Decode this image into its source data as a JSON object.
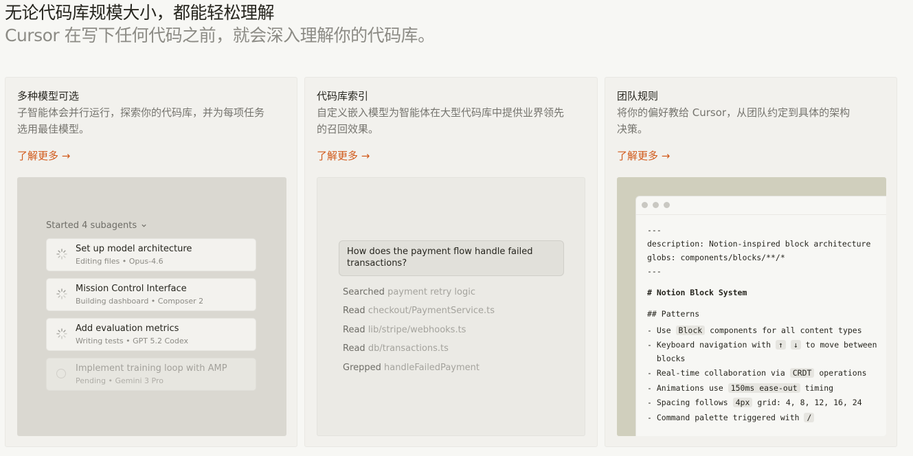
{
  "hero": {
    "title": "无论代码库规模大小，都能轻松理解",
    "subtitle": "Cursor 在写下任何代码之前，就会深入理解你的代码库。"
  },
  "colors": {
    "accent": "#d15a1b"
  },
  "cards": [
    {
      "title": "多种模型可选",
      "desc_line1": "子智能体会并行运行，探索你的代码库，并为每项任务",
      "desc_line2": "选用最佳模型。",
      "learn_more": "了解更多 →",
      "started": "Started 4 subagents",
      "tasks": [
        {
          "title": "Set up model architecture",
          "meta": "Editing files • Opus-4.6"
        },
        {
          "title": "Mission Control Interface",
          "meta": "Building dashboard • Composer 2"
        },
        {
          "title": "Add evaluation metrics",
          "meta": "Writing tests • GPT 5.2 Codex"
        },
        {
          "title": "Implement training loop with AMP",
          "meta": "Pending • Gemini 3 Pro"
        }
      ]
    },
    {
      "title": "代码库索引",
      "desc_line1": "自定义嵌入模型为智能体在大型代码库中提供业界领先",
      "desc_line2": "的召回效果。",
      "learn_more": "了解更多 →",
      "question": "How does the payment flow handle failed transactions?",
      "steps": [
        {
          "verb": "Searched",
          "arg": "payment retry logic"
        },
        {
          "verb": "Read",
          "arg": "checkout/PaymentService.ts"
        },
        {
          "verb": "Read",
          "arg": "lib/stripe/webhooks.ts"
        },
        {
          "verb": "Read",
          "arg": "db/transactions.ts"
        },
        {
          "verb": "Grepped",
          "arg": "handleFailedPayment"
        }
      ]
    },
    {
      "title": "团队规则",
      "desc_line1": "将你的偏好教给 Cursor，从团队约定到具体的架构",
      "desc_line2": "决策。",
      "learn_more": "了解更多 →",
      "code": {
        "fm_open": "---",
        "description": "description: Notion-inspired block architecture",
        "globs": "globs: components/blocks/**/*",
        "fm_close": "---",
        "h1": "# Notion Block System",
        "h2": "## Patterns",
        "b1_pre": "- Use ",
        "b1_pill": "Block",
        "b1_post": " components for all content types",
        "b2_pre": "- Keyboard navigation with ",
        "b2_pill1": "↑",
        "b2_mid": " ",
        "b2_pill2": "↓",
        "b2_post": " to move between",
        "b2_cont": "  blocks",
        "b3_pre": "- Real-time collaboration via ",
        "b3_pill": "CRDT",
        "b3_post": " operations",
        "b4_pre": "- Animations use ",
        "b4_pill": "150ms ease-out",
        "b4_post": " timing",
        "b5_pre": "- Spacing follows ",
        "b5_pill": "4px",
        "b5_post": " grid: 4, 8, 12, 16, 24",
        "b6_pre": "- Command palette triggered with ",
        "b6_pill": "/"
      }
    }
  ]
}
